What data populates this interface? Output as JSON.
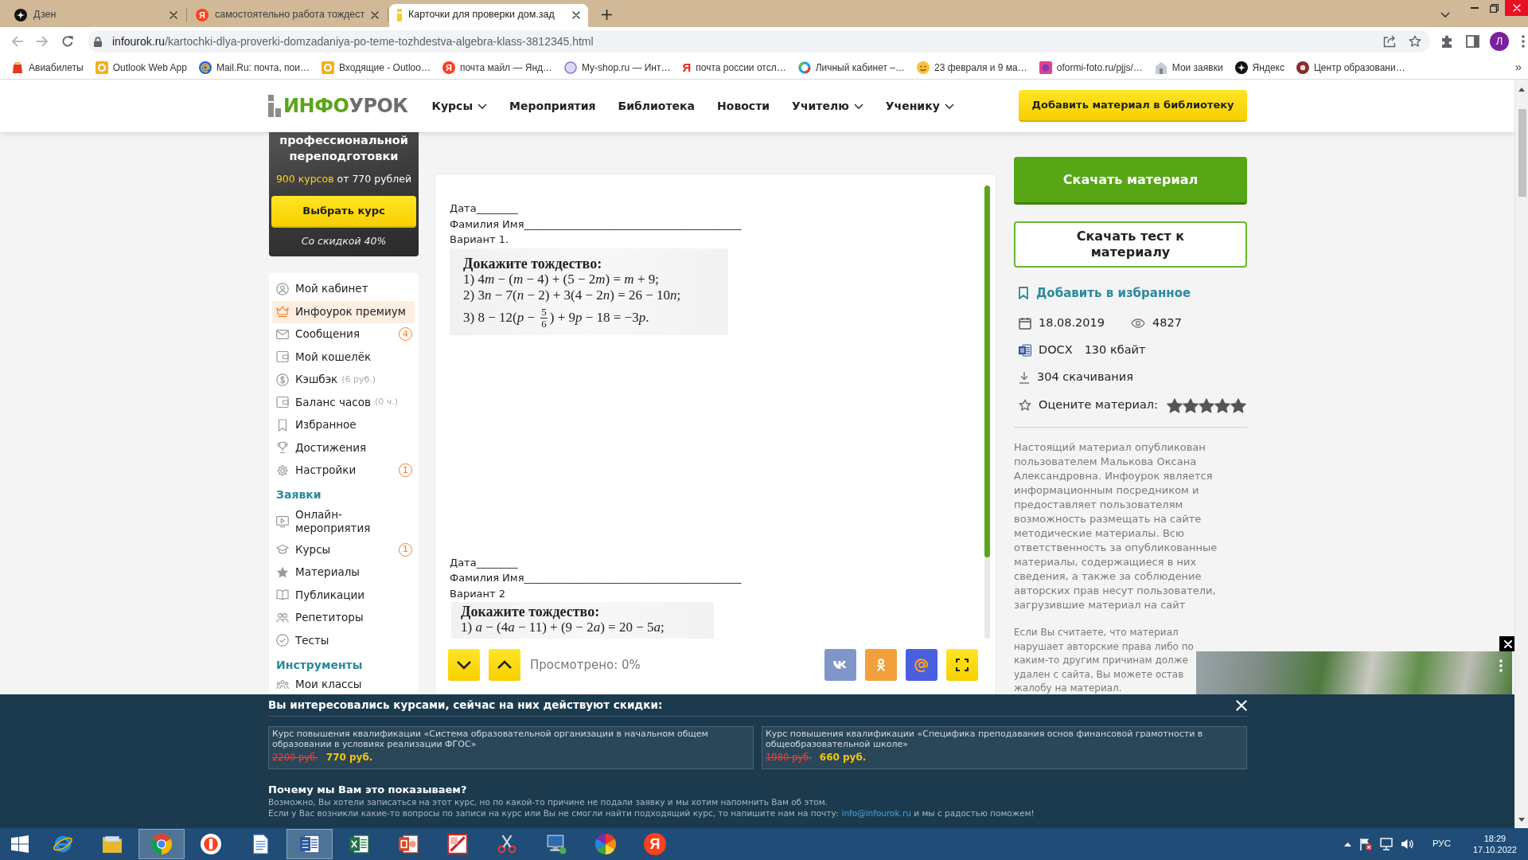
{
  "browser": {
    "tabs": [
      {
        "title": "Дзен",
        "selected": false
      },
      {
        "title": "самостоятельно работа тождест",
        "selected": false,
        "icon_char": "Я"
      },
      {
        "title": "Карточки для проверки дом.зад",
        "selected": true
      }
    ],
    "url": {
      "domain": "infourok.ru",
      "path": "/kartochki-dlya-proverki-domzadaniya-po-teme-tozhdestva-algebra-klass-3812345.html"
    },
    "profile_initial": "Л",
    "bookmarks": [
      {
        "label": "Авиабилеты"
      },
      {
        "label": "Outlook Web App"
      },
      {
        "label": "Mail.Ru: почта, пои…"
      },
      {
        "label": "Входящие - Outloo…"
      },
      {
        "label": "почта майл — Янд…",
        "icon_char": "Я"
      },
      {
        "label": "My-shop.ru — Инт…"
      },
      {
        "label": "почта россии отсл…",
        "icon_letter": "Я"
      },
      {
        "label": "Личный кабинет –…"
      },
      {
        "label": "23 февраля и 9 ма…"
      },
      {
        "label": "oformi-foto.ru/pjjs/…"
      },
      {
        "label": "Мои заявки"
      },
      {
        "label": "Яндекс"
      },
      {
        "label": "Центр образовани…"
      }
    ],
    "bookmarks_more": "»"
  },
  "site": {
    "logo": {
      "first": "ИНФО",
      "second": "УРОК"
    },
    "nav": [
      {
        "label": "Курсы",
        "dropdown": true
      },
      {
        "label": "Мероприятия",
        "dropdown": false
      },
      {
        "label": "Библиотека",
        "dropdown": false
      },
      {
        "label": "Новости",
        "dropdown": false
      },
      {
        "label": "Учителю",
        "dropdown": true
      },
      {
        "label": "Ученику",
        "dropdown": true
      }
    ],
    "add_button": "Добавить материал в библиотеку"
  },
  "promo": {
    "lines": [
      "профессиональной",
      "переподготовки"
    ],
    "courses_count": "900 курсов",
    "price": "от 770 рублей",
    "button": "Выбрать курс",
    "discount": "Со скидкой 40%"
  },
  "sidebar": {
    "items": [
      {
        "kind": "item",
        "label": "Мой кабинет",
        "selected": false
      },
      {
        "kind": "item",
        "label": "Инфоурок премиум",
        "selected": true
      },
      {
        "kind": "item",
        "label": "Сообщения",
        "selected": false,
        "badge": "4"
      },
      {
        "kind": "item",
        "label": "Мой кошелёк",
        "selected": false
      },
      {
        "kind": "item",
        "label": "Кэшбэк",
        "note": "(6 руб.)",
        "selected": false
      },
      {
        "kind": "item",
        "label": "Баланс часов",
        "note": "(0 ч.)",
        "selected": false
      },
      {
        "kind": "item",
        "label": "Избранное",
        "selected": false
      },
      {
        "kind": "item",
        "label": "Достижения",
        "selected": false
      },
      {
        "kind": "item",
        "label": "Настройки",
        "selected": false,
        "badge": "1"
      },
      {
        "kind": "section",
        "label": "Заявки"
      },
      {
        "kind": "item",
        "label": "Онлайн-мероприятия",
        "selected": false
      },
      {
        "kind": "item",
        "label": "Курсы",
        "selected": false,
        "badge": "1"
      },
      {
        "kind": "item",
        "label": "Материалы",
        "selected": false
      },
      {
        "kind": "item",
        "label": "Публикации",
        "selected": false
      },
      {
        "kind": "item",
        "label": "Репетиторы",
        "selected": false
      },
      {
        "kind": "item",
        "label": "Тесты",
        "selected": false
      },
      {
        "kind": "section",
        "label": "Инструменты"
      },
      {
        "kind": "item",
        "label": "Мои классы",
        "selected": false
      }
    ]
  },
  "document": {
    "variants": [
      {
        "date_line": "Дата________",
        "name_line": "Фамилия Имя__________________________________________",
        "title": "Вариант 1.",
        "task": "Докажите тождество:",
        "lines": [
          {
            "kind": "text",
            "text": "1) 4m − (m − 4) + (5 − 2m) = m + 9;"
          },
          {
            "kind": "text",
            "text": "2) 3n − 7(n − 2) + 3(4 − 2n) = 26 − 10n;"
          },
          {
            "kind": "fraction",
            "before": "3) 8 − 12(p − ",
            "numerator": "5",
            "denominator": "6",
            "after": ") + 9p − 18 = −3p."
          }
        ]
      },
      {
        "date_line": "Дата________",
        "name_line": "Фамилия Имя__________________________________________",
        "title": "Вариант 2",
        "task": "Докажите тождество:",
        "lines": [
          {
            "kind": "text",
            "text": "1) a − (4a − 11) + (9 − 2a) = 20 − 5a;"
          }
        ]
      }
    ],
    "viewed": "Просмотрено: 0%"
  },
  "material": {
    "download": "Скачать материал",
    "download_test": "Скачать тест к материалу",
    "favorite": "Добавить в избранное",
    "date": "18.08.2019",
    "views": "4827",
    "format": "DOCX",
    "size": "130 кбайт",
    "downloads": "304 скачивания",
    "rate_label": "Оцените материал:",
    "stars": 5,
    "disclaimer": "Настоящий материал опубликован пользователем Малькова Оксана Александровна. Инфоурок является информационным посредником и предоставляет пользователям возможность размещать на сайте методические материалы. Всю ответственность за опубликованные материалы, содержащиеся в них сведения, а также за соблюдение авторских прав несут пользователи, загрузившие материал на сайт",
    "complaint_lines": [
      "Если Вы считаете, что материал",
      "нарушает авторские права либо по",
      "каким-то другим причинам долже",
      "удален с сайта, Вы можете остав",
      "жалобу на материал."
    ]
  },
  "offer_banner": {
    "title": "Вы интересовались курсами, сейчас на них действуют скидки:",
    "courses": [
      {
        "title": "Курс повышения квалификации «Система образовательной организации в начальном общем образовании в условиях реализации ФГОС»",
        "old_price": "2200 руб.",
        "new_price": "770 руб."
      },
      {
        "title": "Курс повышения квалификации «Специфика преподавания основ финансовой грамотности в общеобразовательной школе»",
        "old_price": "1980 руб.",
        "new_price": "660 руб."
      }
    ],
    "why_title": "Почему мы Вам это показываем?",
    "why_text": "Возможно, Вы хотели записаться на этот курс, но по какой-то причине не подали заявку и мы хотим напомнить Вам об этом.",
    "contact_text": "Если у Вас возникли какие-то вопросы по записи на курс или Вы не смогли найти подходящий курс, то напишите нам на почту:",
    "email": "info@infourok.ru",
    "contact_tail": "и мы с радостью поможем!"
  },
  "taskbar": {
    "apps": [
      {
        "active": false
      },
      {
        "active": false
      },
      {
        "active": true
      },
      {
        "active": false
      },
      {
        "active": false
      },
      {
        "active": true
      },
      {
        "active": false
      },
      {
        "active": false
      },
      {
        "active": false
      },
      {
        "active": false
      },
      {
        "active": false
      },
      {
        "active": false
      },
      {
        "active": false,
        "icon_char": "Я"
      }
    ],
    "language": "РУС",
    "time": "18:29",
    "date": "17.10.2022"
  }
}
